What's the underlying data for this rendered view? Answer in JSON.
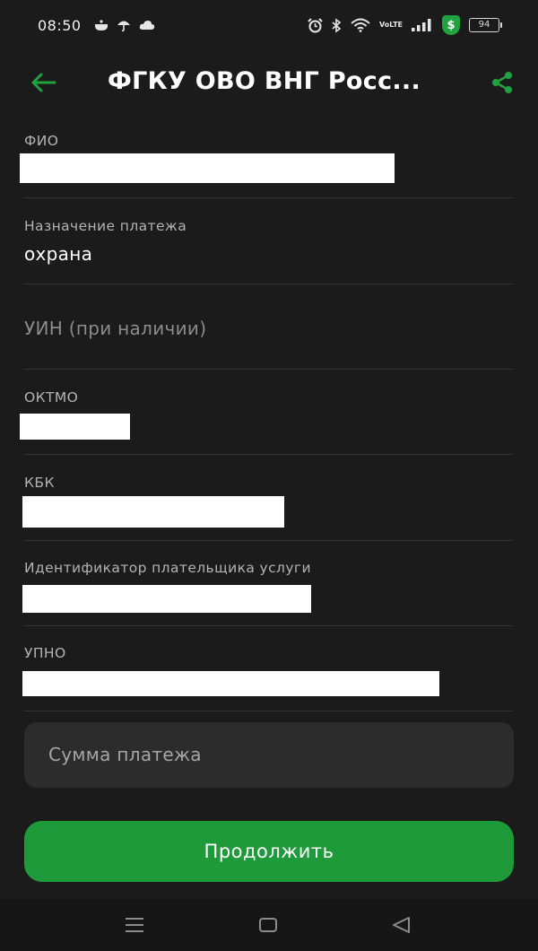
{
  "status_bar": {
    "time": "08:50",
    "battery": "94",
    "shield_symbol": "$",
    "volte_top": "Vo",
    "volte_bottom": "LTE",
    "left_icons": [
      "pot-icon",
      "umbrella-icon",
      "cloud-icon"
    ],
    "right_icons": [
      "alarm-icon",
      "bluetooth-icon",
      "wifi-icon",
      "volte-icon",
      "signal-icon",
      "shield-dollar-icon",
      "battery-icon"
    ]
  },
  "header": {
    "title": "ФГКУ ОВО ВНГ Росс...",
    "back_icon": "arrow-left-icon",
    "share_icon": "share-icon",
    "accent_color": "#1fa23f"
  },
  "form": {
    "fio": {
      "label": "ФИО",
      "value_hidden": true
    },
    "purpose": {
      "label": "Назначение платежа",
      "value": "охрана"
    },
    "uin": {
      "placeholder": "УИН (при наличии)"
    },
    "oktmo": {
      "label": "ОКТМО",
      "value_hidden": true
    },
    "kbk": {
      "label": "КБК",
      "value_hidden": true
    },
    "payer_id": {
      "label": "Идентификатор плательщика услуги",
      "value_hidden": true
    },
    "upno": {
      "label": "УПНО",
      "value_hidden": true
    },
    "amount": {
      "placeholder": "Сумма платежа"
    }
  },
  "actions": {
    "continue_label": "Продолжить",
    "button_color": "#1e9a3a"
  },
  "nav_bar": {
    "items": [
      "menu-icon",
      "home-icon",
      "back-triangle-icon"
    ]
  }
}
